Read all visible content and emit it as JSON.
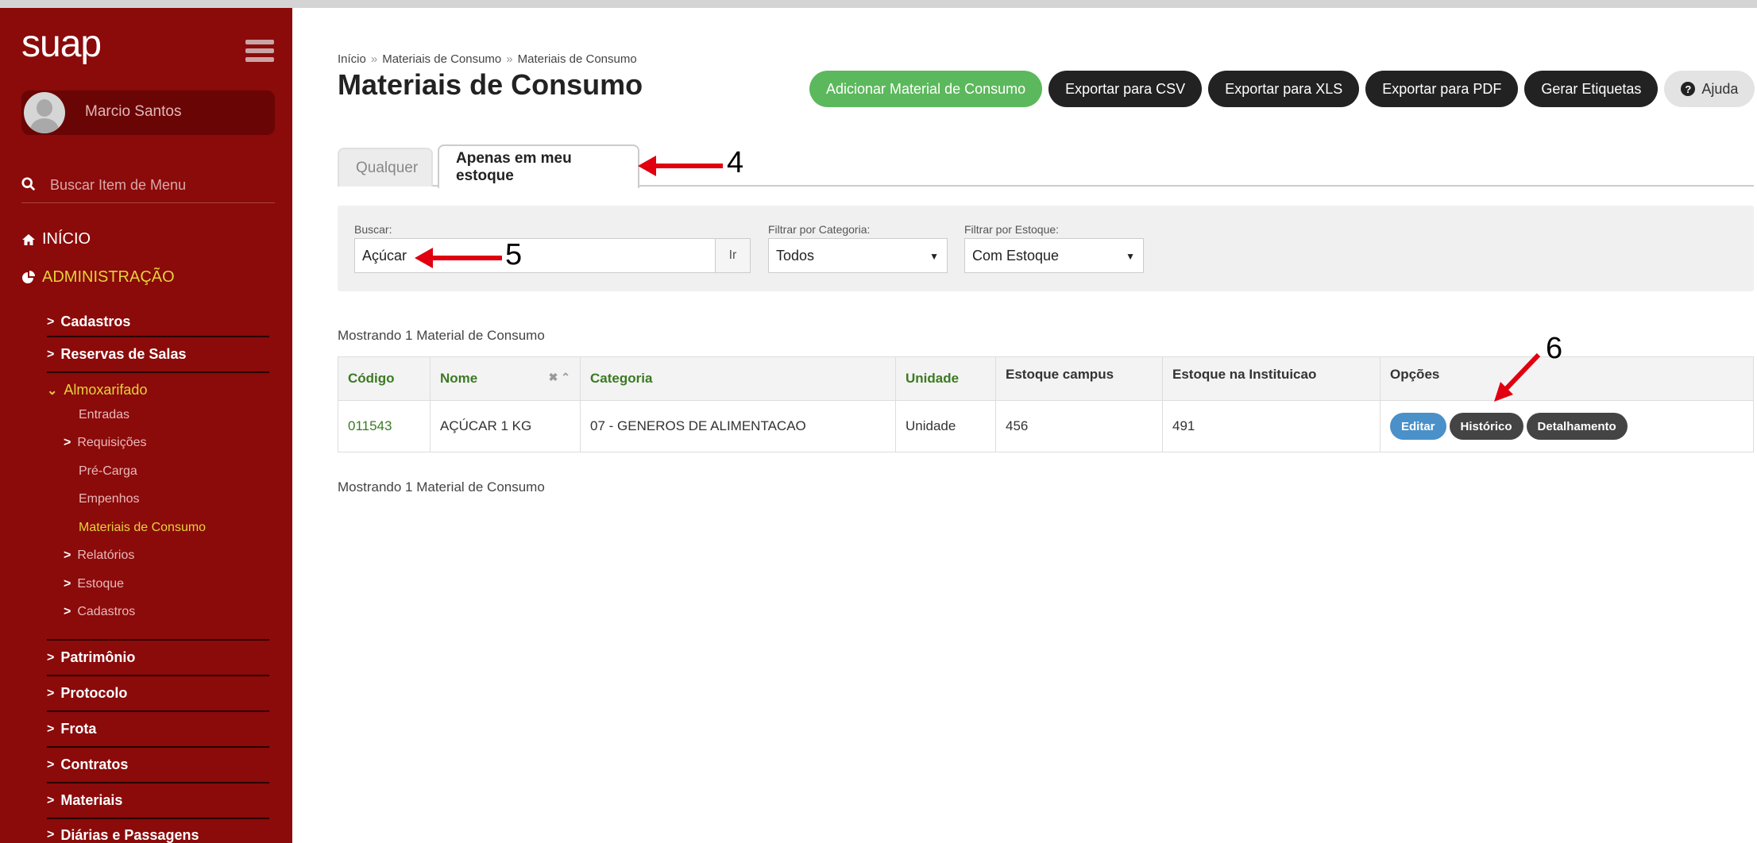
{
  "sidebar": {
    "logo": "suap",
    "user_name": "Marcio Santos",
    "search_placeholder": "Buscar Item de Menu",
    "inicio": "INÍCIO",
    "administracao": "ADMINISTRAÇÃO",
    "items": [
      "Cadastros",
      "Reservas de Salas",
      "Almoxarifado",
      "Patrimônio",
      "Protocolo",
      "Frota",
      "Contratos",
      "Materiais",
      "Diárias e Passagens"
    ],
    "almox": [
      "Entradas",
      "Requisições",
      "Pré-Carga",
      "Empenhos",
      "Materiais de Consumo",
      "Relatórios",
      "Estoque",
      "Cadastros"
    ]
  },
  "breadcrumb": [
    "Início",
    "Materiais de Consumo",
    "Materiais de Consumo"
  ],
  "page_title": "Materiais de Consumo",
  "actions": {
    "add": "Adicionar Material de Consumo",
    "csv": "Exportar para CSV",
    "xls": "Exportar para XLS",
    "pdf": "Exportar para PDF",
    "labels": "Gerar Etiquetas",
    "help": "Ajuda"
  },
  "tabs": [
    "Qualquer",
    "Apenas em meu estoque"
  ],
  "filters": {
    "search_label": "Buscar:",
    "search_value": "Açúcar",
    "go": "Ir",
    "category_label": "Filtrar por Categoria:",
    "category_value": "Todos",
    "stock_label": "Filtrar por Estoque:",
    "stock_value": "Com Estoque"
  },
  "count_text": "Mostrando 1 Material de Consumo",
  "table": {
    "headers": [
      "Código",
      "Nome",
      "Categoria",
      "Unidade",
      "Estoque campus",
      "Estoque na Instituicao",
      "Opções"
    ],
    "rows": [
      {
        "codigo": "011543",
        "nome": "AÇÚCAR 1 KG",
        "categoria": "07 - GENEROS DE ALIMENTACAO",
        "unidade": "Unidade",
        "estoque_campus": "456",
        "estoque_instituicao": "491",
        "options": [
          "Editar",
          "Histórico",
          "Detalhamento"
        ]
      }
    ]
  },
  "annotations": [
    "4",
    "5",
    "6"
  ],
  "colors": {
    "sidebar": "#8b0a0a",
    "accent_yellow": "#e6d23a",
    "green": "#5cb85c",
    "link_green": "#3b7a22",
    "arrow_red": "#e0000f"
  }
}
